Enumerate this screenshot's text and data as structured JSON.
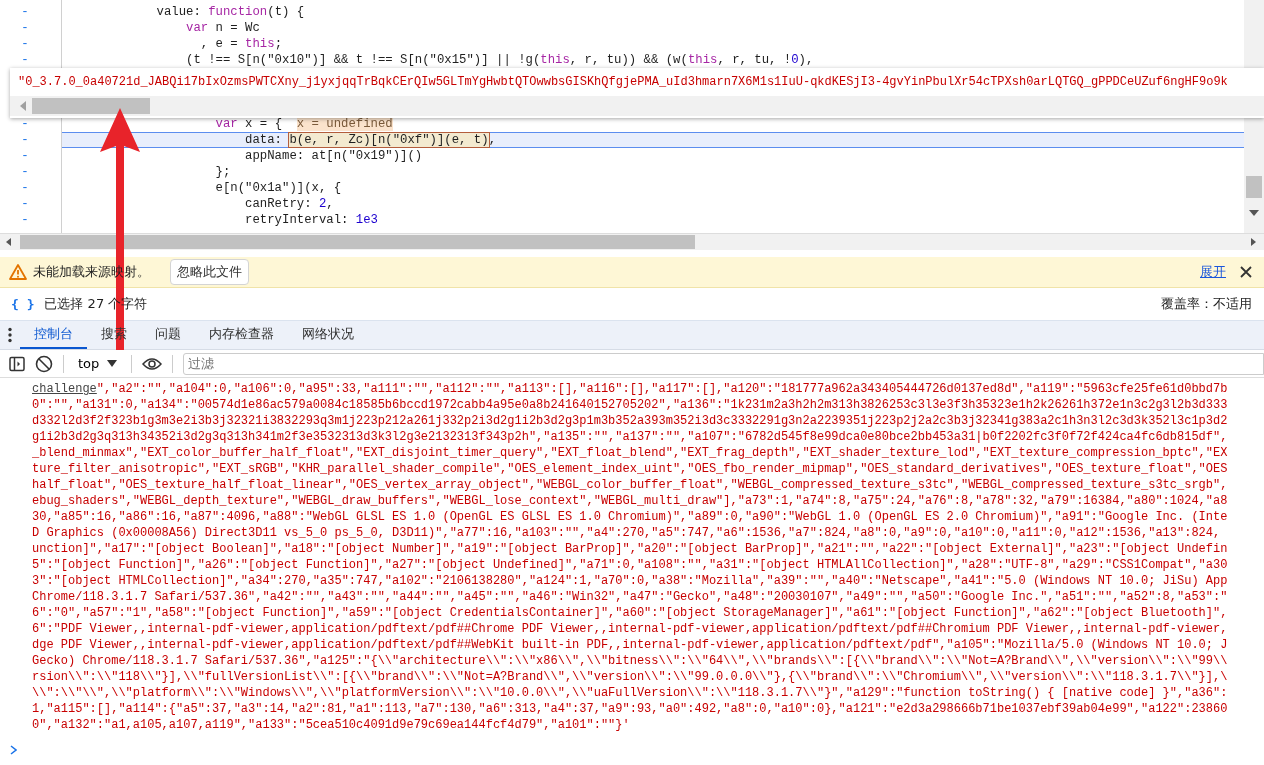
{
  "editor": {
    "lines_before": [
      {
        "gutter": "-",
        "tokens": [
          {
            "t": "            value: "
          },
          {
            "kind": "keyword",
            "t": "function"
          },
          {
            "t": "(t) {"
          }
        ]
      },
      {
        "gutter": "-",
        "tokens": [
          {
            "kind": "keyword",
            "t": "                var"
          },
          {
            "t": " n = Wc"
          }
        ]
      },
      {
        "gutter": "-",
        "tokens": [
          {
            "t": "                  , e = "
          },
          {
            "kind": "keyword",
            "t": "this"
          },
          {
            "t": ";"
          }
        ]
      },
      {
        "gutter": "-",
        "tokens": [
          {
            "t": "                (t !== S[n(\"0x10\")] && t !== S[n(\"0x15\")] || !g("
          },
          {
            "kind": "keyword",
            "t": "this"
          },
          {
            "t": ", r, tu)) && (w("
          },
          {
            "kind": "keyword",
            "t": "this"
          },
          {
            "t": ", r, tu, !"
          },
          {
            "kind": "number",
            "t": "0"
          },
          {
            "t": "),"
          }
        ]
      }
    ],
    "popover": {
      "value": "\"0_3.7.0_0a40721d_JABQi17bIxOzmsPWTCXny_j1yxjqqTrBqkCErQIw5GLTmYgHwbtQTOwwbsGISKhQfgjePMA_uId3hmarn7X6M1s1IuU-qkdKESjI3-4gvYinPbulXr54cTPXsh0arLQTGQ_gPPDCeUZuf6ngHF9o9k"
    },
    "lines_after": [
      {
        "gutter": "-",
        "highlighted": false,
        "tokens": [
          {
            "kind": "keyword",
            "t": "                    var"
          },
          {
            "t": " x = {  "
          },
          {
            "kind": "hint",
            "t": "x = undefined"
          }
        ]
      },
      {
        "gutter": "-",
        "highlighted": true,
        "tokens": [
          {
            "t": "                        data: "
          },
          {
            "kind": "evaluated",
            "t": "b(e, r, Zc)[n(\"0xf\")](e, t)"
          },
          {
            "t": ","
          }
        ]
      },
      {
        "gutter": "-",
        "highlighted": false,
        "tokens": [
          {
            "t": "                        appName: at[n(\"0x19\")]()"
          }
        ]
      },
      {
        "gutter": "-",
        "highlighted": false,
        "tokens": [
          {
            "t": "                    };"
          }
        ]
      },
      {
        "gutter": "-",
        "highlighted": false,
        "tokens": [
          {
            "t": "                    e[n(\"0x1a\")](x, {"
          }
        ]
      },
      {
        "gutter": "-",
        "highlighted": false,
        "tokens": [
          {
            "t": "                        canRetry: "
          },
          {
            "kind": "number",
            "t": "2"
          },
          {
            "t": ","
          }
        ]
      },
      {
        "gutter": "-",
        "highlighted": false,
        "tokens": [
          {
            "t": "                        retryInterval: "
          },
          {
            "kind": "number",
            "t": "1e3"
          }
        ]
      }
    ]
  },
  "warning_bar": {
    "message": "未能加载来源映射。",
    "button": "忽略此文件",
    "link": "展开"
  },
  "selection_bar": {
    "format_icon": "{ }",
    "status": "已选择 27 个字符",
    "coverage": "覆盖率：不适用"
  },
  "tabs": [
    {
      "label": "控制台",
      "selected": true
    },
    {
      "label": "搜索",
      "selected": false
    },
    {
      "label": "问题",
      "selected": false
    },
    {
      "label": "内存检查器",
      "selected": false
    },
    {
      "label": "网络状况",
      "selected": false
    }
  ],
  "console_toolbar": {
    "context": "top",
    "filter": {
      "placeholder": "过滤"
    }
  },
  "console": {
    "link": "challenge",
    "lines": [
      "\",\"a2\":\"\",\"a104\":0,\"a106\":0,\"a95\":33,\"a111\":\"\",\"a112\":\"\",\"a113\":[],\"a116\":[],\"a117\":[],\"a120\":\"181777a962a343405444726d0137ed8d\",\"a119\":\"5963cfe25fe61d0bbd7b",
      "0\":\"\",\"a131\":0,\"a134\":\"00574d1e86ac579a0084c18585b6bccd1972cabb4a95e0a8b241640152705202\",\"a136\":\"1k231m2a3h2h2m313h3826253c3l3e3f3h35323e1h2k26261h372e1n3c2g3l2b3d333",
      "d332l2d3f2f323b1g3m3e2i3b3j32321i3832293q3m1j223p212a261j332p2i3d2g1i2b3d2g3p1m3b352a393m352i3d3c3332291g3n2a2239351j223p2j2a2c3b3j32341g383a2c1h3n3l2c3d3k352l3c1p3d2",
      "g1i2b3d2g3q313h34352i3d2g3q313h341m2f3e3532313d3k3l2g3e2132313f343p2h\",\"a135\":\"\",\"a137\":\"\",\"a107\":\"6782d545f8e99dca0e80bce2bb453a31|b0f2202fc3f0f72f424ca4fc6db815df\",",
      "_blend_minmax\",\"EXT_color_buffer_half_float\",\"EXT_disjoint_timer_query\",\"EXT_float_blend\",\"EXT_frag_depth\",\"EXT_shader_texture_lod\",\"EXT_texture_compression_bptc\",\"EX",
      "ture_filter_anisotropic\",\"EXT_sRGB\",\"KHR_parallel_shader_compile\",\"OES_element_index_uint\",\"OES_fbo_render_mipmap\",\"OES_standard_derivatives\",\"OES_texture_float\",\"OES",
      "half_float\",\"OES_texture_half_float_linear\",\"OES_vertex_array_object\",\"WEBGL_color_buffer_float\",\"WEBGL_compressed_texture_s3tc\",\"WEBGL_compressed_texture_s3tc_srgb\",",
      "ebug_shaders\",\"WEBGL_depth_texture\",\"WEBGL_draw_buffers\",\"WEBGL_lose_context\",\"WEBGL_multi_draw\"],\"a73\":1,\"a74\":8,\"a75\":24,\"a76\":8,\"a78\":32,\"a79\":16384,\"a80\":1024,\"a8",
      "30,\"a85\":16,\"a86\":16,\"a87\":4096,\"a88\":\"WebGL GLSL ES 1.0 (OpenGL ES GLSL ES 1.0 Chromium)\",\"a89\":0,\"a90\":\"WebGL 1.0 (OpenGL ES 2.0 Chromium)\",\"a91\":\"Google Inc. (Inte",
      "D Graphics (0x00008A56) Direct3D11 vs_5_0 ps_5_0, D3D11)\",\"a77\":16,\"a103\":\"\",\"a4\":270,\"a5\":747,\"a6\":1536,\"a7\":824,\"a8\":0,\"a9\":0,\"a10\":0,\"a11\":0,\"a12\":1536,\"a13\":824,",
      "unction]\",\"a17\":\"[object Boolean]\",\"a18\":\"[object Number]\",\"a19\":\"[object BarProp]\",\"a20\":\"[object BarProp]\",\"a21\":\"\",\"a22\":\"[object External]\",\"a23\":\"[object Undefin",
      "5\":\"[object Function]\",\"a26\":\"[object Function]\",\"a27\":\"[object Undefined]\",\"a71\":0,\"a108\":\"\",\"a31\":\"[object HTMLAllCollection]\",\"a28\":\"UTF-8\",\"a29\":\"CSS1Compat\",\"a30",
      "3\":\"[object HTMLCollection]\",\"a34\":270,\"a35\":747,\"a102\":\"2106138280\",\"a124\":1,\"a70\":0,\"a38\":\"Mozilla\",\"a39\":\"\",\"a40\":\"Netscape\",\"a41\":\"5.0 (Windows NT 10.0; JiSu) App",
      "Chrome/118.3.1.7 Safari/537.36\",\"a42\":\"\",\"a43\":\"\",\"a44\":\"\",\"a45\":\"\",\"a46\":\"Win32\",\"a47\":\"Gecko\",\"a48\":\"20030107\",\"a49\":\"\",\"a50\":\"Google Inc.\",\"a51\":\"\",\"a52\":8,\"a53\":\"",
      "6\":\"0\",\"a57\":\"1\",\"a58\":\"[object Function]\",\"a59\":\"[object CredentialsContainer]\",\"a60\":\"[object StorageManager]\",\"a61\":\"[object Function]\",\"a62\":\"[object Bluetooth]\",",
      "6\":\"PDF Viewer,,internal-pdf-viewer,application/pdftext/pdf##Chrome PDF Viewer,,internal-pdf-viewer,application/pdftext/pdf##Chromium PDF Viewer,,internal-pdf-viewer,",
      "dge PDF Viewer,,internal-pdf-viewer,application/pdftext/pdf##WebKit built-in PDF,,internal-pdf-viewer,application/pdftext/pdf\",\"a105\":\"Mozilla/5.0 (Windows NT 10.0; J",
      "Gecko) Chrome/118.3.1.7 Safari/537.36\",\"a125\":\"{\\\\\"architecture\\\\\":\\\\\"x86\\\\\",\\\\\"bitness\\\\\":\\\\\"64\\\\\",\\\\\"brands\\\\\":[{\\\\\"brand\\\\\":\\\\\"Not=A?Brand\\\\\",\\\\\"version\\\\\":\\\\\"99\\\\",
      "rsion\\\\\":\\\\\"118\\\\\"}],\\\\\"fullVersionList\\\\\":[{\\\\\"brand\\\\\":\\\\\"Not=A?Brand\\\\\",\\\\\"version\\\\\":\\\\\"99.0.0.0\\\\\"},{\\\\\"brand\\\\\":\\\\\"Chromium\\\\\",\\\\\"version\\\\\":\\\\\"118.3.1.7\\\\\"}],\\",
      "\\\\\":\\\\\"\\\\\",\\\\\"platform\\\\\":\\\\\"Windows\\\\\",\\\\\"platformVersion\\\\\":\\\\\"10.0.0\\\\\",\\\\\"uaFullVersion\\\\\":\\\\\"118.3.1.7\\\\\"}\",\"a129\":\"function toString() { [native code] }\",\"a36\":",
      "1,\"a115\":[],\"a114\":{\"a5\":37,\"a3\":14,\"a2\":81,\"a1\":113,\"a7\":130,\"a6\":313,\"a4\":37,\"a9\":93,\"a0\":492,\"a8\":0,\"a10\":0},\"a121\":\"e2d3a298666b71be1037ebf39ab04e99\",\"a122\":23860",
      "0\",\"a132\":\"a1,a105,a107,a119\",\"a133\":\"5cea510c4091d9e79c69ea144fcf4d79\",\"a101\":\"\"}'"
    ]
  }
}
